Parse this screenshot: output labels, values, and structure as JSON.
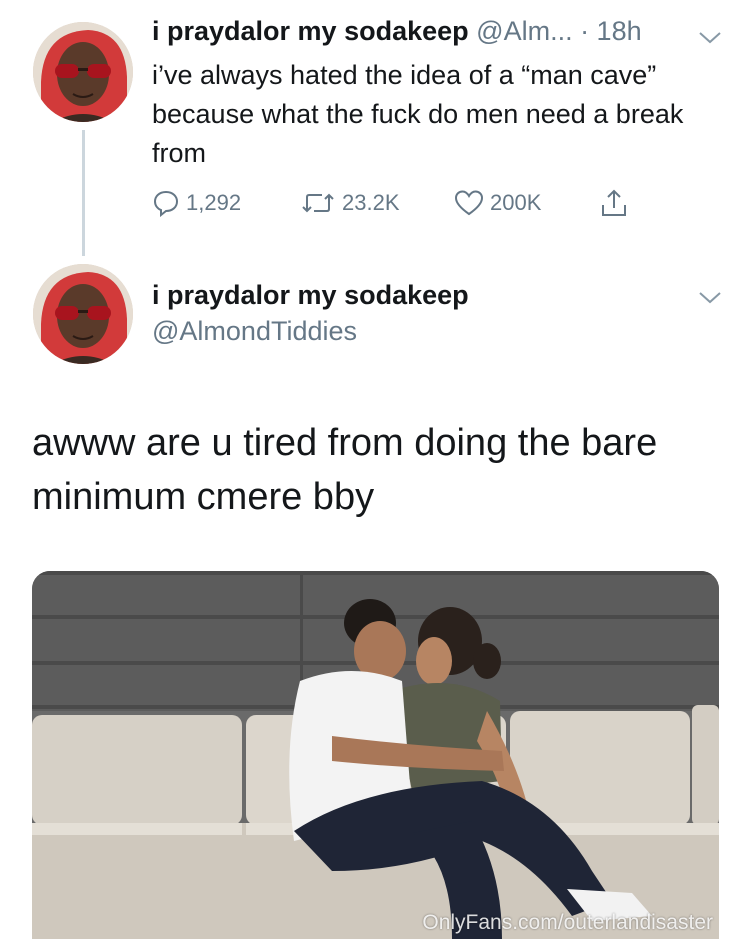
{
  "tweet1": {
    "display_name": "i praydalor my sodakeep",
    "handle_time": "@Alm... · 18h",
    "text": "i’ve always hated the idea of a “man cave” because what the fuck do men need a break from",
    "actions": {
      "reply_count": "1,292",
      "retweet_count": "23.2K",
      "like_count": "200K"
    }
  },
  "tweet2": {
    "display_name": "i praydalor my sodakeep",
    "handle": "@AlmondTiddies",
    "text": "awww are u tired from doing the bare minimum cmere bby"
  },
  "photo": {
    "watermark": "OnlyFans.com/outerlandisaster"
  },
  "icons": {
    "reply": "speech-bubble-icon",
    "retweet": "retweet-arrows-icon",
    "like": "heart-icon",
    "share": "share-upload-icon",
    "menu": "chevron-down-icon"
  },
  "colors": {
    "text": "#14171a",
    "secondary": "#657786",
    "thread_line": "#ccd6dd"
  }
}
